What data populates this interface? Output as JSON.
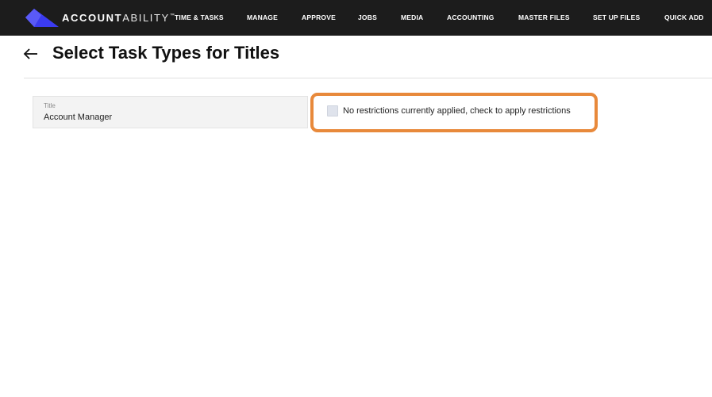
{
  "app": {
    "logo_bold": "ACCOUNT",
    "logo_light": "ABILITY",
    "logo_tm": "™",
    "brand_color": "#3b3bf0"
  },
  "nav": {
    "items": [
      {
        "label": "TIME & TASKS"
      },
      {
        "label": "MANAGE"
      },
      {
        "label": "APPROVE"
      },
      {
        "label": "JOBS"
      },
      {
        "label": "MEDIA"
      },
      {
        "label": "ACCOUNTING"
      },
      {
        "label": "MASTER FILES"
      },
      {
        "label": "SET UP FILES"
      },
      {
        "label": "QUICK ADD"
      }
    ]
  },
  "page": {
    "title": "Select Task Types for Titles",
    "back_icon": "arrow-left-icon"
  },
  "form": {
    "title_label": "Title",
    "title_value": "Account Manager",
    "restriction_checked": false,
    "restriction_label": "No restrictions currently applied, check to apply restrictions",
    "highlight_color": "#e8893b"
  }
}
